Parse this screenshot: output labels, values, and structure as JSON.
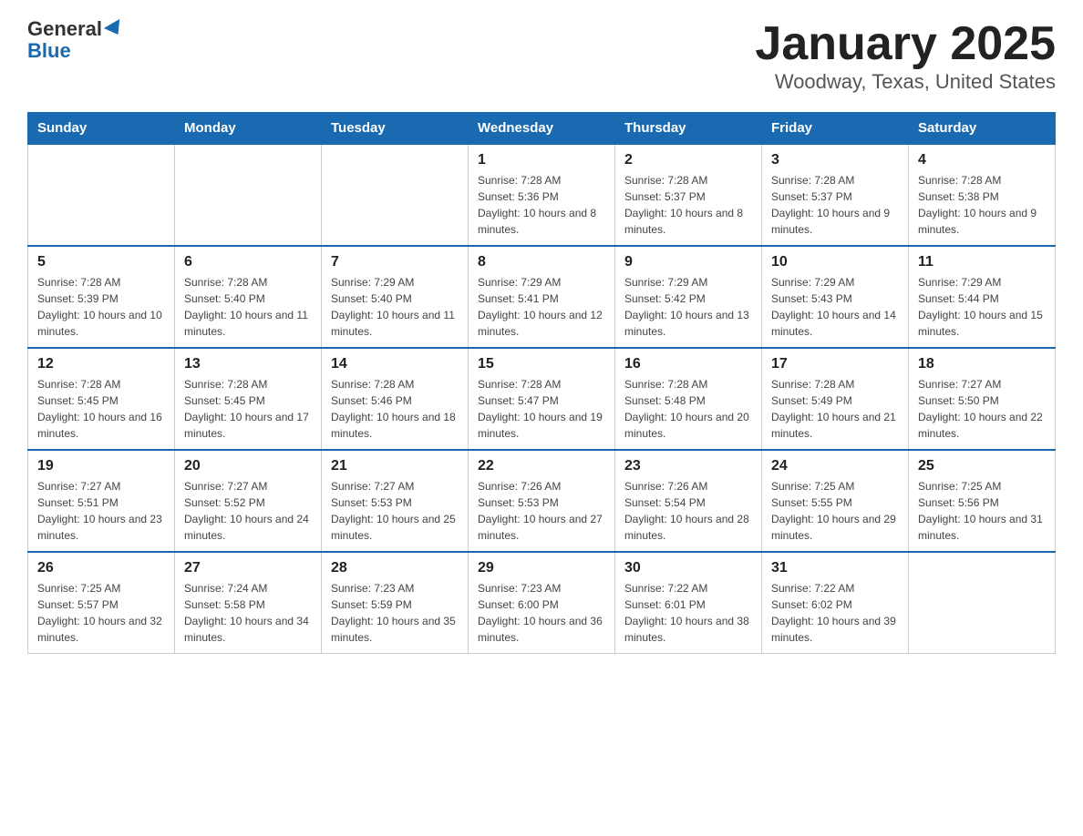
{
  "logo": {
    "general": "General",
    "blue": "Blue"
  },
  "title": "January 2025",
  "subtitle": "Woodway, Texas, United States",
  "days_of_week": [
    "Sunday",
    "Monday",
    "Tuesday",
    "Wednesday",
    "Thursday",
    "Friday",
    "Saturday"
  ],
  "weeks": [
    [
      {
        "day": "",
        "info": ""
      },
      {
        "day": "",
        "info": ""
      },
      {
        "day": "",
        "info": ""
      },
      {
        "day": "1",
        "info": "Sunrise: 7:28 AM\nSunset: 5:36 PM\nDaylight: 10 hours and 8 minutes."
      },
      {
        "day": "2",
        "info": "Sunrise: 7:28 AM\nSunset: 5:37 PM\nDaylight: 10 hours and 8 minutes."
      },
      {
        "day": "3",
        "info": "Sunrise: 7:28 AM\nSunset: 5:37 PM\nDaylight: 10 hours and 9 minutes."
      },
      {
        "day": "4",
        "info": "Sunrise: 7:28 AM\nSunset: 5:38 PM\nDaylight: 10 hours and 9 minutes."
      }
    ],
    [
      {
        "day": "5",
        "info": "Sunrise: 7:28 AM\nSunset: 5:39 PM\nDaylight: 10 hours and 10 minutes."
      },
      {
        "day": "6",
        "info": "Sunrise: 7:28 AM\nSunset: 5:40 PM\nDaylight: 10 hours and 11 minutes."
      },
      {
        "day": "7",
        "info": "Sunrise: 7:29 AM\nSunset: 5:40 PM\nDaylight: 10 hours and 11 minutes."
      },
      {
        "day": "8",
        "info": "Sunrise: 7:29 AM\nSunset: 5:41 PM\nDaylight: 10 hours and 12 minutes."
      },
      {
        "day": "9",
        "info": "Sunrise: 7:29 AM\nSunset: 5:42 PM\nDaylight: 10 hours and 13 minutes."
      },
      {
        "day": "10",
        "info": "Sunrise: 7:29 AM\nSunset: 5:43 PM\nDaylight: 10 hours and 14 minutes."
      },
      {
        "day": "11",
        "info": "Sunrise: 7:29 AM\nSunset: 5:44 PM\nDaylight: 10 hours and 15 minutes."
      }
    ],
    [
      {
        "day": "12",
        "info": "Sunrise: 7:28 AM\nSunset: 5:45 PM\nDaylight: 10 hours and 16 minutes."
      },
      {
        "day": "13",
        "info": "Sunrise: 7:28 AM\nSunset: 5:45 PM\nDaylight: 10 hours and 17 minutes."
      },
      {
        "day": "14",
        "info": "Sunrise: 7:28 AM\nSunset: 5:46 PM\nDaylight: 10 hours and 18 minutes."
      },
      {
        "day": "15",
        "info": "Sunrise: 7:28 AM\nSunset: 5:47 PM\nDaylight: 10 hours and 19 minutes."
      },
      {
        "day": "16",
        "info": "Sunrise: 7:28 AM\nSunset: 5:48 PM\nDaylight: 10 hours and 20 minutes."
      },
      {
        "day": "17",
        "info": "Sunrise: 7:28 AM\nSunset: 5:49 PM\nDaylight: 10 hours and 21 minutes."
      },
      {
        "day": "18",
        "info": "Sunrise: 7:27 AM\nSunset: 5:50 PM\nDaylight: 10 hours and 22 minutes."
      }
    ],
    [
      {
        "day": "19",
        "info": "Sunrise: 7:27 AM\nSunset: 5:51 PM\nDaylight: 10 hours and 23 minutes."
      },
      {
        "day": "20",
        "info": "Sunrise: 7:27 AM\nSunset: 5:52 PM\nDaylight: 10 hours and 24 minutes."
      },
      {
        "day": "21",
        "info": "Sunrise: 7:27 AM\nSunset: 5:53 PM\nDaylight: 10 hours and 25 minutes."
      },
      {
        "day": "22",
        "info": "Sunrise: 7:26 AM\nSunset: 5:53 PM\nDaylight: 10 hours and 27 minutes."
      },
      {
        "day": "23",
        "info": "Sunrise: 7:26 AM\nSunset: 5:54 PM\nDaylight: 10 hours and 28 minutes."
      },
      {
        "day": "24",
        "info": "Sunrise: 7:25 AM\nSunset: 5:55 PM\nDaylight: 10 hours and 29 minutes."
      },
      {
        "day": "25",
        "info": "Sunrise: 7:25 AM\nSunset: 5:56 PM\nDaylight: 10 hours and 31 minutes."
      }
    ],
    [
      {
        "day": "26",
        "info": "Sunrise: 7:25 AM\nSunset: 5:57 PM\nDaylight: 10 hours and 32 minutes."
      },
      {
        "day": "27",
        "info": "Sunrise: 7:24 AM\nSunset: 5:58 PM\nDaylight: 10 hours and 34 minutes."
      },
      {
        "day": "28",
        "info": "Sunrise: 7:23 AM\nSunset: 5:59 PM\nDaylight: 10 hours and 35 minutes."
      },
      {
        "day": "29",
        "info": "Sunrise: 7:23 AM\nSunset: 6:00 PM\nDaylight: 10 hours and 36 minutes."
      },
      {
        "day": "30",
        "info": "Sunrise: 7:22 AM\nSunset: 6:01 PM\nDaylight: 10 hours and 38 minutes."
      },
      {
        "day": "31",
        "info": "Sunrise: 7:22 AM\nSunset: 6:02 PM\nDaylight: 10 hours and 39 minutes."
      },
      {
        "day": "",
        "info": ""
      }
    ]
  ]
}
